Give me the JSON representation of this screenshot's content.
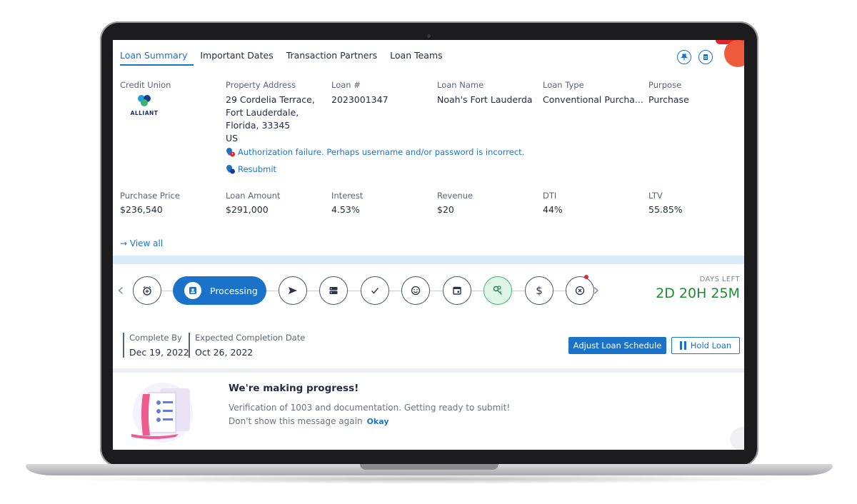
{
  "tabs": [
    "Loan Summary",
    "Important Dates",
    "Transaction Partners",
    "Loan Teams"
  ],
  "top_icons": [
    "pin-icon",
    "document-icon",
    "notification-bell-icon"
  ],
  "credit_union": {
    "label": "Credit Union",
    "logo_text": "ALLIANT"
  },
  "property_address": {
    "label": "Property Address",
    "lines": [
      "29 Cordelia Terrace,",
      "Fort Lauderdale,",
      "Florida, 33345",
      "US"
    ]
  },
  "loan_number": {
    "label": "Loan #",
    "value": "2023001347"
  },
  "loan_name": {
    "label": "Loan Name",
    "value": "Noah's Fort Lauderda"
  },
  "loan_type": {
    "label": "Loan Type",
    "value": "Conventional Purcha..."
  },
  "purpose": {
    "label": "Purpose",
    "value": "Purchase"
  },
  "alert": {
    "message": "Authorization failure.  Perhaps username and/or password is incorrect.",
    "resubmit": "Resubmit"
  },
  "financials": [
    {
      "label": "Purchase Price",
      "value": "$236,540"
    },
    {
      "label": "Loan Amount",
      "value": "$291,000"
    },
    {
      "label": "Interest",
      "value": "4.53%"
    },
    {
      "label": "Revenue",
      "value": "$20"
    },
    {
      "label": "DTI",
      "value": "44%"
    },
    {
      "label": "LTV",
      "value": "55.85%"
    }
  ],
  "view_all": "→ View all",
  "stepper": {
    "active_label": "Processing",
    "steps": [
      "alarm-clock-icon",
      "send-icon",
      "server-icon",
      "checkmark-icon",
      "smiley-icon",
      "calendar-icon",
      "keys-icon",
      "dollar-icon",
      "close-circle-icon"
    ],
    "days_left_label": "DAYS LEFT",
    "days_left_value": "2D 20H 25M"
  },
  "dates": {
    "complete_by_label": "Complete By",
    "complete_by_value": "Dec 19, 2022",
    "expected_label": "Expected Completion Date",
    "expected_value": "Oct 26, 2022"
  },
  "buttons": {
    "adjust": "Adjust Loan Schedule",
    "hold": "Hold Loan"
  },
  "progress_message": {
    "title": "We're making progress!",
    "body": "Verification of 1003 and documentation. Getting ready to submit!",
    "dont_show": "Don't show this message again",
    "okay": "Okay"
  },
  "colors": {
    "accent": "#1a73c8",
    "days_left": "#1e8a2f",
    "notification": "#ee5a3c"
  }
}
